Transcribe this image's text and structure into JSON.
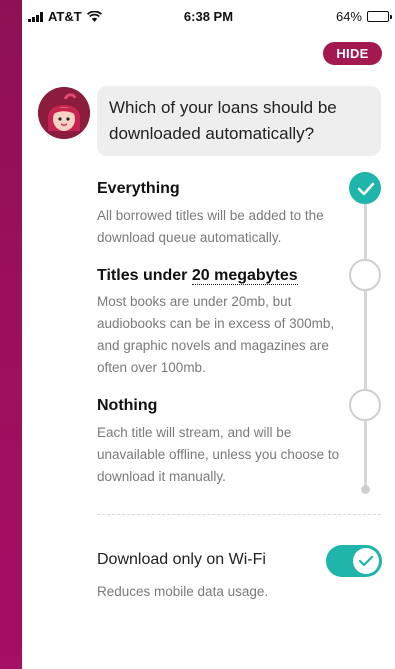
{
  "status_bar": {
    "carrier": "AT&T",
    "time": "6:38 PM",
    "battery": "64%",
    "battery_level": 0.64
  },
  "header": {
    "hide_label": "HIDE"
  },
  "prompt": {
    "question": "Which of your loans should be downloaded automatically?"
  },
  "options": [
    {
      "title": "Everything",
      "description": "All borrowed titles will be added to the download queue automatically.",
      "selected": true
    },
    {
      "title_prefix": "Titles under ",
      "title_link": "20 megabytes",
      "description": "Most books are under 20mb, but audiobooks can be in excess of 300mb, and graphic novels and magazines are often over 100mb.",
      "selected": false
    },
    {
      "title": "Nothing",
      "description": "Each title will stream, and will be unavailable offline, unless you choose to download it manually.",
      "selected": false
    }
  ],
  "wifi_setting": {
    "label": "Download only on Wi-Fi",
    "description": "Reduces mobile data usage.",
    "enabled": true
  },
  "colors": {
    "accent": "#20b5ab",
    "brand": "#a3184f",
    "background": "#9c0f5c"
  }
}
